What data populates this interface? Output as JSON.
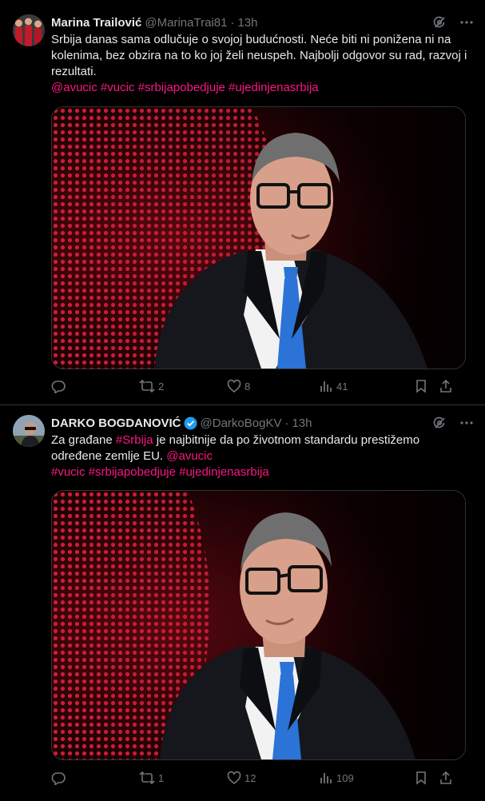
{
  "colors": {
    "background": "#000000",
    "text": "#e7e9ea",
    "muted": "#71767b",
    "hashtag": "#f91880",
    "verified": "#1d9bf0",
    "border": "#2f3336"
  },
  "tweets": [
    {
      "name": "Marina Trailović",
      "handle": "@MarinaTrai81",
      "dot": "·",
      "time": "13h",
      "text_plain": "Srbija danas sama odlučuje o svojoj budućnosti. Neće biti ni ponižena ni na kolenima, bez obzira na to ko joj želi neuspeh. Najbolji odgovor su rad, razvoj i rezultati.",
      "tags": [
        "@avucic",
        "#vucic",
        "#srbijapobedjuje",
        "#ujedinjenasrbija"
      ],
      "replies": "",
      "retweets": "2",
      "likes": "8",
      "views": "41",
      "icons": [
        "grok-icon",
        "more-icon",
        "reply-icon",
        "retweet-icon",
        "like-icon",
        "views-icon",
        "bookmark-icon",
        "share-icon"
      ]
    },
    {
      "name": "DARKO BOGDANOVIĆ",
      "handle": "@DarkoBogKV",
      "dot": "·",
      "time": "13h",
      "verified": true,
      "text_pre": "Za građane ",
      "text_tag1": "#Srbija",
      "text_mid": " je najbitnije da po životnom standardu prestižemo određene zemlje EU. ",
      "text_tag2": "@avucic",
      "tags": [
        "#vucic",
        "#srbijapobedjuje",
        "#ujedinjenasrbija"
      ],
      "replies": "",
      "retweets": "1",
      "likes": "12",
      "views": "109",
      "icons": [
        "grok-icon",
        "more-icon",
        "reply-icon",
        "retweet-icon",
        "like-icon",
        "views-icon",
        "bookmark-icon",
        "share-icon"
      ]
    }
  ]
}
